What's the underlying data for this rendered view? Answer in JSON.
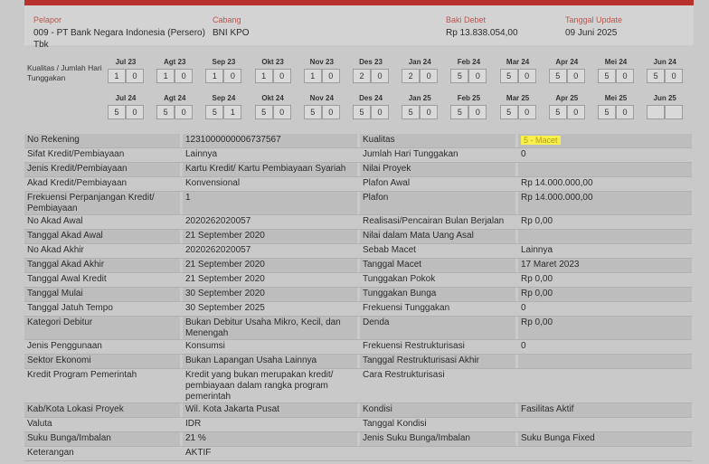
{
  "header": {
    "pelapor_label": "Pelapor",
    "pelapor_value": "009 - PT Bank Negara Indonesia (Persero) Tbk",
    "cabang_label": "Cabang",
    "cabang_value": "BNI KPO",
    "baki_label": "Baki Debet",
    "baki_value": "Rp 13.838.054,00",
    "tanggal_label": "Tanggal Update",
    "tanggal_value": "09 Juni 2025"
  },
  "kualitas_label": "Kualitas / Jumlah Hari Tunggakan",
  "history_row1": [
    {
      "month": "Jul 23",
      "q": "1",
      "d": "0"
    },
    {
      "month": "Agt 23",
      "q": "1",
      "d": "0"
    },
    {
      "month": "Sep 23",
      "q": "1",
      "d": "0"
    },
    {
      "month": "Okt 23",
      "q": "1",
      "d": "0"
    },
    {
      "month": "Nov 23",
      "q": "1",
      "d": "0"
    },
    {
      "month": "Des 23",
      "q": "2",
      "d": "0"
    },
    {
      "month": "Jan 24",
      "q": "2",
      "d": "0"
    },
    {
      "month": "Feb 24",
      "q": "5",
      "d": "0"
    },
    {
      "month": "Mar 24",
      "q": "5",
      "d": "0"
    },
    {
      "month": "Apr 24",
      "q": "5",
      "d": "0"
    },
    {
      "month": "Mei 24",
      "q": "5",
      "d": "0"
    },
    {
      "month": "Jun 24",
      "q": "5",
      "d": "0"
    }
  ],
  "history_row2": [
    {
      "month": "Jul 24",
      "q": "5",
      "d": "0"
    },
    {
      "month": "Agt 24",
      "q": "5",
      "d": "0"
    },
    {
      "month": "Sep 24",
      "q": "5",
      "d": "1"
    },
    {
      "month": "Okt 24",
      "q": "5",
      "d": "0"
    },
    {
      "month": "Nov 24",
      "q": "5",
      "d": "0"
    },
    {
      "month": "Des 24",
      "q": "5",
      "d": "0"
    },
    {
      "month": "Jan 25",
      "q": "5",
      "d": "0"
    },
    {
      "month": "Feb 25",
      "q": "5",
      "d": "0"
    },
    {
      "month": "Mar 25",
      "q": "5",
      "d": "0"
    },
    {
      "month": "Apr 25",
      "q": "5",
      "d": "0"
    },
    {
      "month": "Mei 25",
      "q": "5",
      "d": "0"
    },
    {
      "month": "Jun 25",
      "q": "",
      "d": ""
    }
  ],
  "rows": [
    {
      "l1": "No Rekening",
      "v1": "1231000000006737567",
      "l2": "Kualitas",
      "v2": "5 - Macet"
    },
    {
      "l1": "Sifat Kredit/Pembiayaan",
      "v1": "Lainnya",
      "l2": "Jumlah Hari Tunggakan",
      "v2": "0"
    },
    {
      "l1": "Jenis Kredit/Pembiayaan",
      "v1": "Kartu Kredit/ Kartu Pembiayaan Syariah",
      "l2": "Nilai Proyek",
      "v2": ""
    },
    {
      "l1": "Akad Kredit/Pembiayaan",
      "v1": "Konvensional",
      "l2": "Plafon Awal",
      "v2": "Rp 14.000.000,00"
    },
    {
      "l1": "Frekuensi Perpanjangan Kredit/ Pembiayaan",
      "v1": "1",
      "l2": "Plafon",
      "v2": "Rp 14.000.000,00"
    },
    {
      "l1": "No Akad Awal",
      "v1": "2020262020057",
      "l2": "Realisasi/Pencairan Bulan Berjalan",
      "v2": "Rp 0,00"
    },
    {
      "l1": "Tanggal Akad Awal",
      "v1": "21 September 2020",
      "l2": "Nilai dalam Mata Uang Asal",
      "v2": ""
    },
    {
      "l1": "No Akad Akhir",
      "v1": "2020262020057",
      "l2": "Sebab Macet",
      "v2": "Lainnya"
    },
    {
      "l1": "Tanggal Akad Akhir",
      "v1": "21 September 2020",
      "l2": "Tanggal Macet",
      "v2": "17 Maret 2023"
    },
    {
      "l1": "Tanggal Awal Kredit",
      "v1": "21 September 2020",
      "l2": "Tunggakan Pokok",
      "v2": "Rp 0,00"
    },
    {
      "l1": "Tanggal Mulai",
      "v1": "30 September 2020",
      "l2": "Tunggakan Bunga",
      "v2": "Rp 0,00"
    },
    {
      "l1": "Tanggal Jatuh Tempo",
      "v1": "30 September 2025",
      "l2": "Frekuensi Tunggakan",
      "v2": "0"
    },
    {
      "l1": "Kategori Debitur",
      "v1": "Bukan Debitur Usaha Mikro, Kecil, dan Menengah",
      "l2": "Denda",
      "v2": "Rp 0,00"
    },
    {
      "l1": "Jenis Penggunaan",
      "v1": "Konsumsi",
      "l2": "Frekuensi Restrukturisasi",
      "v2": "0"
    },
    {
      "l1": "Sektor Ekonomi",
      "v1": "Bukan Lapangan Usaha Lainnya",
      "l2": "Tanggal Restrukturisasi Akhir",
      "v2": ""
    },
    {
      "l1": "Kredit Program Pemerintah",
      "v1": "Kredit yang bukan merupakan kredit/ pembiayaan dalam rangka program pemerintah",
      "l2": "Cara Restrukturisasi",
      "v2": ""
    },
    {
      "l1": "Kab/Kota Lokasi Proyek",
      "v1": "Wil. Kota Jakarta Pusat",
      "l2": "Kondisi",
      "v2": "Fasilitas Aktif"
    },
    {
      "l1": "Valuta",
      "v1": "IDR",
      "l2": "Tanggal Kondisi",
      "v2": ""
    },
    {
      "l1": "Suku Bunga/Imbalan",
      "v1": "21 %",
      "l2": "Jenis Suku Bunga/Imbalan",
      "v2": "Suku Bunga Fixed"
    },
    {
      "l1": "Keterangan",
      "v1": "AKTIF",
      "l2": "",
      "v2": ""
    }
  ]
}
